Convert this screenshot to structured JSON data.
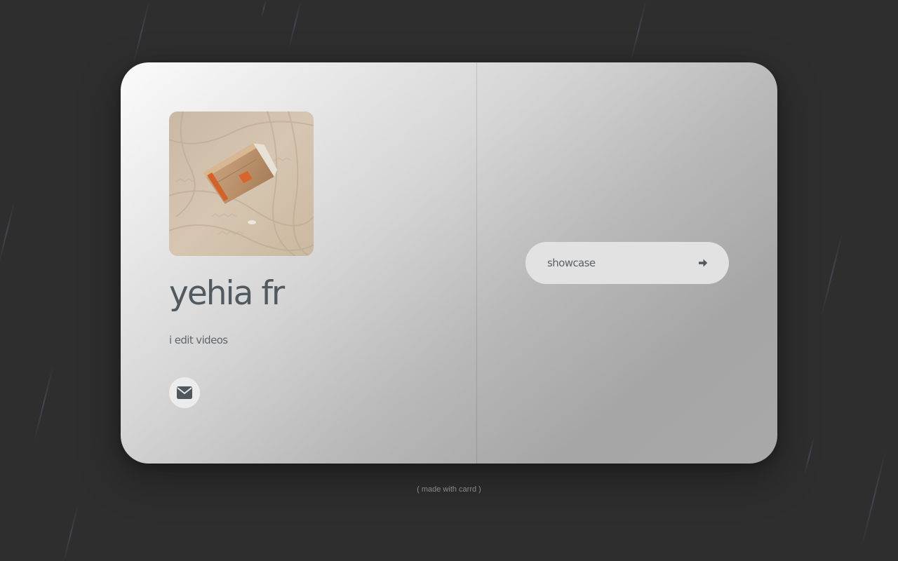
{
  "profile": {
    "name": "yehia fr",
    "tagline": "i edit videos",
    "avatar_icon": "crumpled-paper-bag-on-sand-photo"
  },
  "social": {
    "email_icon": "envelope-icon"
  },
  "showcase": {
    "label": "showcase",
    "icon": "arrow-right-icon"
  },
  "footer": {
    "text": "( made with carrd )"
  },
  "colors": {
    "background": "#2e2e2e",
    "text_primary": "#515a60",
    "button_bg": "#e2e2e2"
  }
}
